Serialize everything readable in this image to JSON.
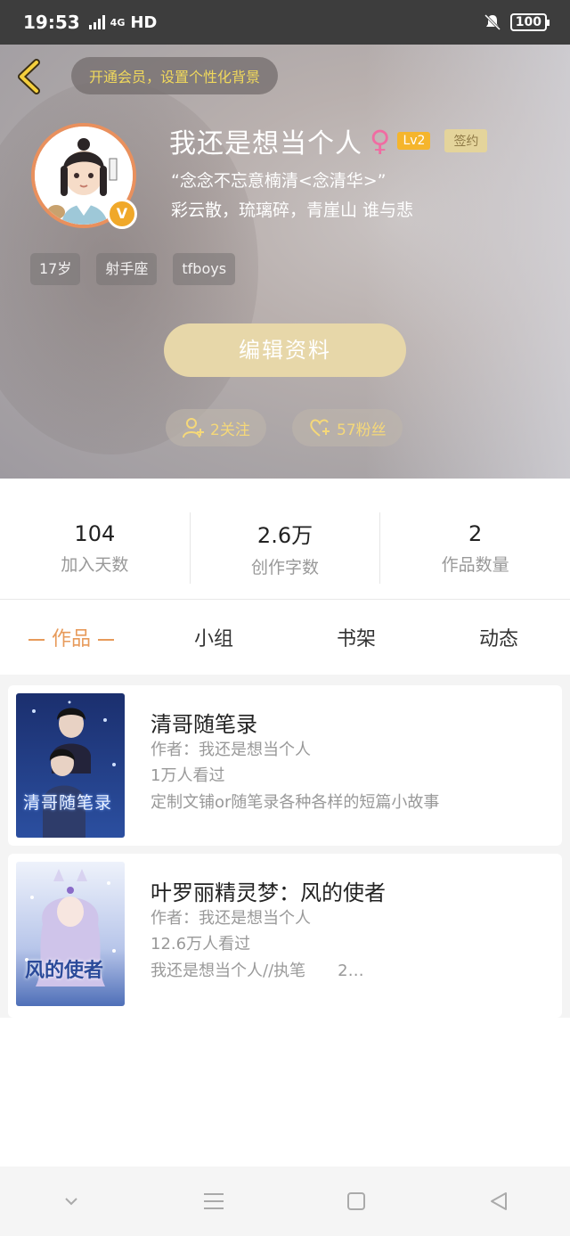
{
  "status_bar": {
    "time": "19:53",
    "network_label": "4G",
    "hd_label": "HD",
    "battery": "100"
  },
  "header": {
    "vip_banner": "开通会员，设置个性化背景",
    "username": "我还是想当个人",
    "gender_symbol": "♀",
    "level": "Lv2",
    "signed_badge": "签约",
    "verified_badge": "V",
    "bio_line1": "“念念不忘意楠清<念清华>”",
    "bio_line2": "彩云散，琉璃碎，青崖山 谁与悲",
    "tags": [
      "17岁",
      "射手座",
      "tfboys"
    ],
    "edit_button": "编辑资料",
    "following": "2关注",
    "fans": "57粉丝"
  },
  "stats": [
    {
      "value": "104",
      "label": "加入天数"
    },
    {
      "value": "2.6万",
      "label": "创作字数"
    },
    {
      "value": "2",
      "label": "作品数量"
    }
  ],
  "tabs": [
    "作品",
    "小组",
    "书架",
    "动态"
  ],
  "works": [
    {
      "title": "清哥随笔录",
      "author": "作者：我还是想当个人",
      "views": "1万人看过",
      "desc": "定制文铺or随笔录各种各样的短篇小故事",
      "cover_text": "清哥随笔录"
    },
    {
      "title": "叶罗丽精灵梦：风的使者",
      "author": "作者：我还是想当个人",
      "views": "12.6万人看过",
      "desc": "我还是想当个人//执笔　　2…",
      "cover_text": "风的使者"
    }
  ],
  "colors": {
    "accent": "#e79a5a",
    "vip_text": "#f0d85c",
    "edit_button": "#e7d7a9",
    "level_badge": "#f5b52c"
  }
}
